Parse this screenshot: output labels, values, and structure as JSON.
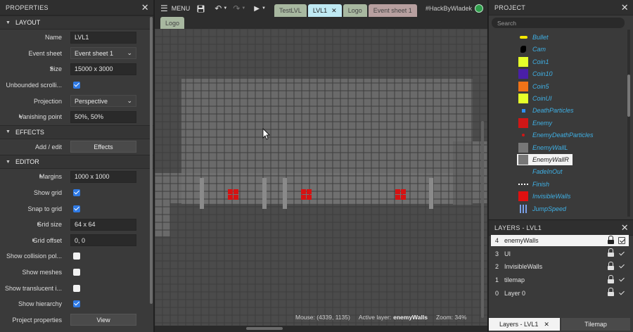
{
  "properties": {
    "title": "PROPERTIES",
    "sections": {
      "layout": "LAYOUT",
      "effects": "EFFECTS",
      "editor": "EDITOR"
    },
    "layout": {
      "name_label": "Name",
      "name_value": "LVL1",
      "eventsheet_label": "Event sheet",
      "eventsheet_value": "Event sheet 1",
      "size_label": "Size",
      "size_value": "15000 x 3000",
      "unbounded_label": "Unbounded scrolli...",
      "unbounded_checked": true,
      "projection_label": "Projection",
      "projection_value": "Perspective",
      "vanishing_label": "Vanishing point",
      "vanishing_value": "50%, 50%"
    },
    "effects": {
      "addedit_label": "Add / edit",
      "effects_button": "Effects"
    },
    "editor": {
      "margins_label": "Margins",
      "margins_value": "1000 x 1000",
      "showgrid_label": "Show grid",
      "showgrid_checked": true,
      "snapgrid_label": "Snap to grid",
      "snapgrid_checked": true,
      "gridsize_label": "Grid size",
      "gridsize_value": "64 x 64",
      "gridoffset_label": "Grid offset",
      "gridoffset_value": "0, 0",
      "collision_label": "Show collision pol...",
      "collision_checked": false,
      "meshes_label": "Show meshes",
      "meshes_checked": false,
      "translucent_label": "Show translucent i...",
      "translucent_checked": false,
      "hierarchy_label": "Show hierarchy",
      "hierarchy_checked": true,
      "projectprops_label": "Project properties",
      "view_button": "View"
    }
  },
  "toolbar": {
    "menu_label": "MENU",
    "tabs": [
      {
        "label": "TestLVL",
        "bg": "#a8b8a0",
        "fg": "#444"
      },
      {
        "label": "LVL1",
        "bg": "#bfe9f3",
        "fg": "#222"
      },
      {
        "label": "Logo",
        "bg": "#a8b8a0",
        "fg": "#444"
      },
      {
        "label": "Event sheet 1",
        "bg": "#b8a0a0",
        "fg": "#444"
      }
    ],
    "second_row_tab": "Logo",
    "user": "#HackByWladek"
  },
  "status": {
    "mouse": "Mouse: (4339, 1135)",
    "active_layer_prefix": "Active layer:",
    "active_layer": "enemyWalls",
    "zoom": "Zoom: 34%"
  },
  "project": {
    "title": "PROJECT",
    "search_placeholder": "Search",
    "items": [
      {
        "label": "Bullet",
        "icon": "bullet-icon",
        "color": "#f5e800"
      },
      {
        "label": "Cam",
        "icon": "cam-icon",
        "color": "#000000"
      },
      {
        "label": "Coin1",
        "icon": "coin1-icon",
        "color": "#e6ff2a"
      },
      {
        "label": "Coin10",
        "icon": "coin10-icon",
        "color": "#4a1fa8"
      },
      {
        "label": "Coin5",
        "icon": "coin5-icon",
        "color": "#f07318"
      },
      {
        "label": "CoinUI",
        "icon": "coinui-icon",
        "color": "#e6ff2a"
      },
      {
        "label": "DeathParticles",
        "icon": "deathparticles-icon",
        "color": "#2f8ff0"
      },
      {
        "label": "Enemy",
        "icon": "enemy-icon",
        "color": "#d01616"
      },
      {
        "label": "EnemyDeathParticles",
        "icon": "enemydeathparticles-icon",
        "color": "#d01616"
      },
      {
        "label": "EnemyWallL",
        "icon": "enemywalll-icon",
        "color": "#777777"
      },
      {
        "label": "EnemyWallR",
        "icon": "enemywallr-icon",
        "color": "#777777"
      },
      {
        "label": "FadeInOut",
        "icon": "fadeinout-icon",
        "color": "#3a3a3a"
      },
      {
        "label": "Finish",
        "icon": "finish-icon",
        "color": "#ffffff"
      },
      {
        "label": "InvisibleWalls",
        "icon": "invisiblewalls-icon",
        "color": "#e01010"
      },
      {
        "label": "JumpSpeed",
        "icon": "jumpspeed-icon",
        "color": "#7aa0e8"
      }
    ]
  },
  "layers": {
    "title": "LAYERS - LVL1",
    "items": [
      {
        "num": "4",
        "name": "enemyWalls"
      },
      {
        "num": "3",
        "name": "UI"
      },
      {
        "num": "2",
        "name": "InvisibleWalls"
      },
      {
        "num": "1",
        "name": "tilemap"
      },
      {
        "num": "0",
        "name": "Layer 0"
      }
    ],
    "bottom_tabs": [
      "Layers - LVL1",
      "Tilemap"
    ]
  }
}
